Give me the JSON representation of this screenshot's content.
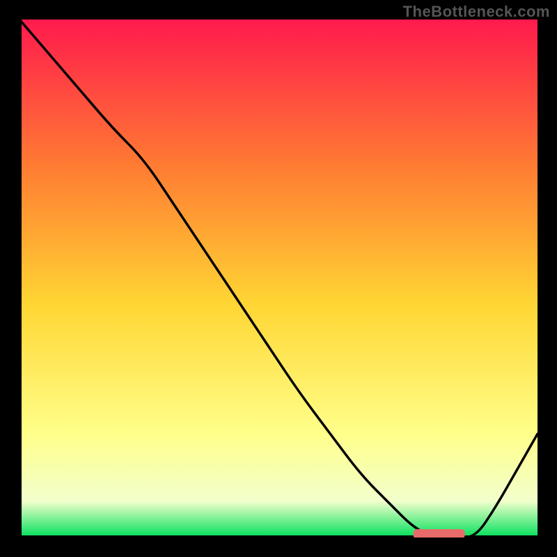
{
  "watermark": "TheBottleneck.com",
  "colors": {
    "background": "#000000",
    "axis": "#000000",
    "curve": "#000000",
    "marker": "#e86b6b",
    "watermark_text": "#555555",
    "grad_top": "#ff1a4d",
    "grad_upper": "#ff7a33",
    "grad_mid": "#ffd633",
    "grad_lower": "#ffff8a",
    "grad_pale": "#f2ffcc",
    "grad_green": "#00e05a"
  },
  "chart_data": {
    "type": "line",
    "title": "",
    "xlabel": "",
    "ylabel": "",
    "xlim": [
      0,
      100
    ],
    "ylim": [
      0,
      100
    ],
    "x": [
      0,
      6,
      12,
      18,
      24,
      30,
      36,
      42,
      48,
      54,
      60,
      66,
      72,
      76,
      80,
      84,
      88,
      92,
      96,
      100
    ],
    "values": [
      100,
      93,
      86,
      79,
      73,
      64,
      55,
      46,
      37,
      28,
      20,
      12,
      6,
      2,
      0,
      0,
      0,
      6,
      13,
      20
    ],
    "marker_segment": {
      "x_start": 76,
      "x_end": 86,
      "y": 0
    },
    "grid": false,
    "legend": false
  }
}
